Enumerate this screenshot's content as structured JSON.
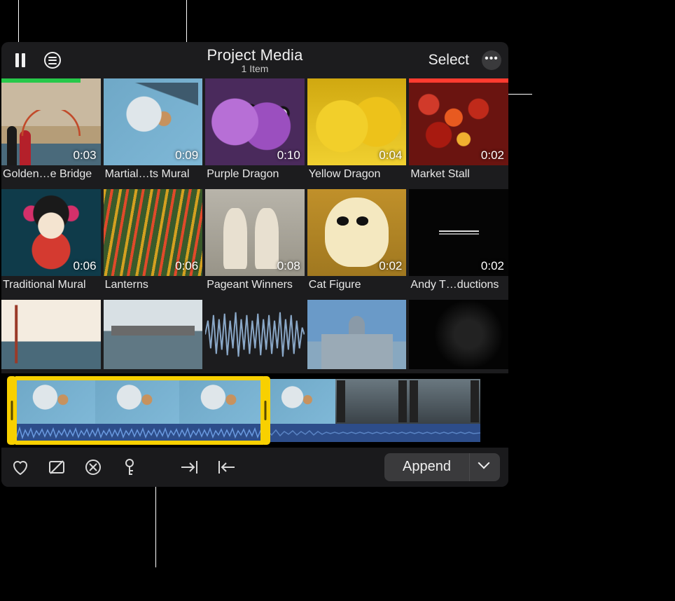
{
  "header": {
    "title": "Project Media",
    "subtitle": "1 Item",
    "select_label": "Select"
  },
  "clips": [
    {
      "label": "Golden…e Bridge",
      "duration": "0:03",
      "mark": "favorite",
      "mark_width": 80,
      "art": "gg"
    },
    {
      "label": "Martial…ts Mural",
      "duration": "0:09",
      "selected": true,
      "art": "mural"
    },
    {
      "label": "Purple Dragon",
      "duration": "0:10",
      "art": "pdragon"
    },
    {
      "label": "Yellow Dragon",
      "duration": "0:04",
      "art": "ydragon"
    },
    {
      "label": "Market Stall",
      "duration": "0:02",
      "mark": "reject",
      "mark_width": 100,
      "art": "market"
    },
    {
      "label": "Traditional Mural",
      "duration": "0:06",
      "art": "trad"
    },
    {
      "label": "Lanterns",
      "duration": "0:06",
      "art": "lanterns"
    },
    {
      "label": "Pageant Winners",
      "duration": "0:08",
      "art": "pageant"
    },
    {
      "label": "Cat Figure",
      "duration": "0:02",
      "art": "cat"
    },
    {
      "label": "Andy T…ductions",
      "duration": "0:02",
      "art": "andy"
    },
    {
      "label": "",
      "duration": "",
      "art": "ggwide",
      "row3": true
    },
    {
      "label": "",
      "duration": "",
      "art": "bay",
      "row3": true
    },
    {
      "label": "",
      "duration": "",
      "art": "wave",
      "row3": true
    },
    {
      "label": "",
      "duration": "",
      "art": "cityhall",
      "row3": true
    },
    {
      "label": "",
      "duration": "",
      "art": "dark",
      "row3": true
    }
  ],
  "toolbar": {
    "append_label": "Append"
  },
  "colors": {
    "selection": "#f8d000",
    "favorite": "#27c84a",
    "reject": "#ff3b30"
  }
}
